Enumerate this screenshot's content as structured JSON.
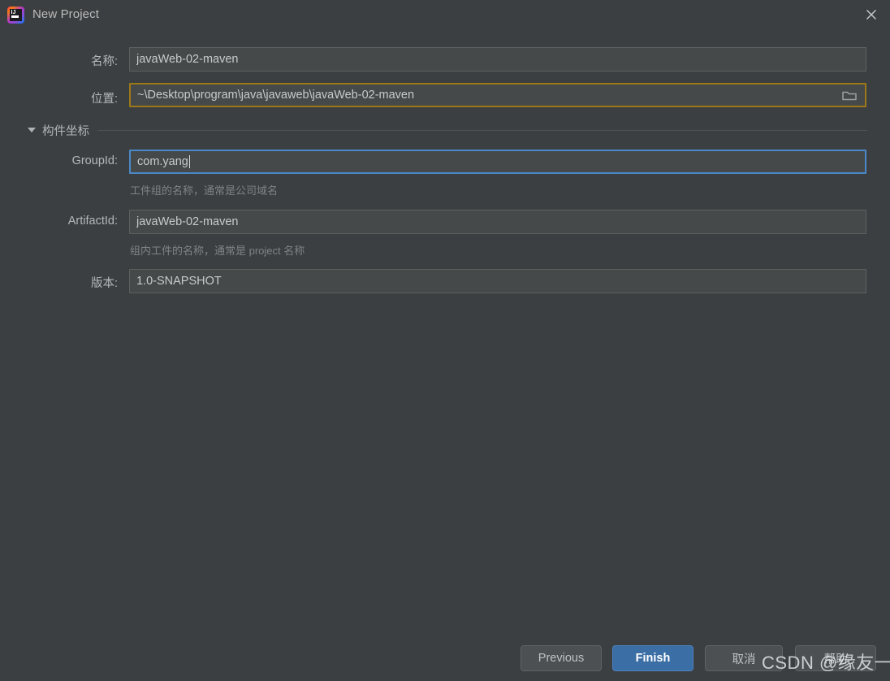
{
  "window": {
    "title": "New Project",
    "app_icon": "intellij-idea-logo",
    "close_icon": "close-icon"
  },
  "form": {
    "name": {
      "label": "名称:",
      "value": "javaWeb-02-maven"
    },
    "location": {
      "label": "位置:",
      "value": "~\\Desktop\\program\\java\\javaweb\\javaWeb-02-maven",
      "browse_icon": "folder-icon",
      "border_color": "#9c7818"
    },
    "section": {
      "label": "构件坐标",
      "expand_icon": "chevron-down-icon",
      "expanded": true
    },
    "group_id": {
      "label": "GroupId:",
      "value": "com.yang",
      "hint": "工件组的名称，通常是公司域名",
      "focused": true,
      "border_color": "#4a88c7"
    },
    "artifact_id": {
      "label": "ArtifactId:",
      "value": "javaWeb-02-maven",
      "hint": "组内工件的名称，通常是 project 名称"
    },
    "version": {
      "label": "版本:",
      "value": "1.0-SNAPSHOT"
    }
  },
  "footer": {
    "previous": "Previous",
    "finish": "Finish",
    "cancel": "取消",
    "help": "帮助",
    "primary_color": "#3b6ea5"
  },
  "watermark": "CSDN @缘友一世"
}
